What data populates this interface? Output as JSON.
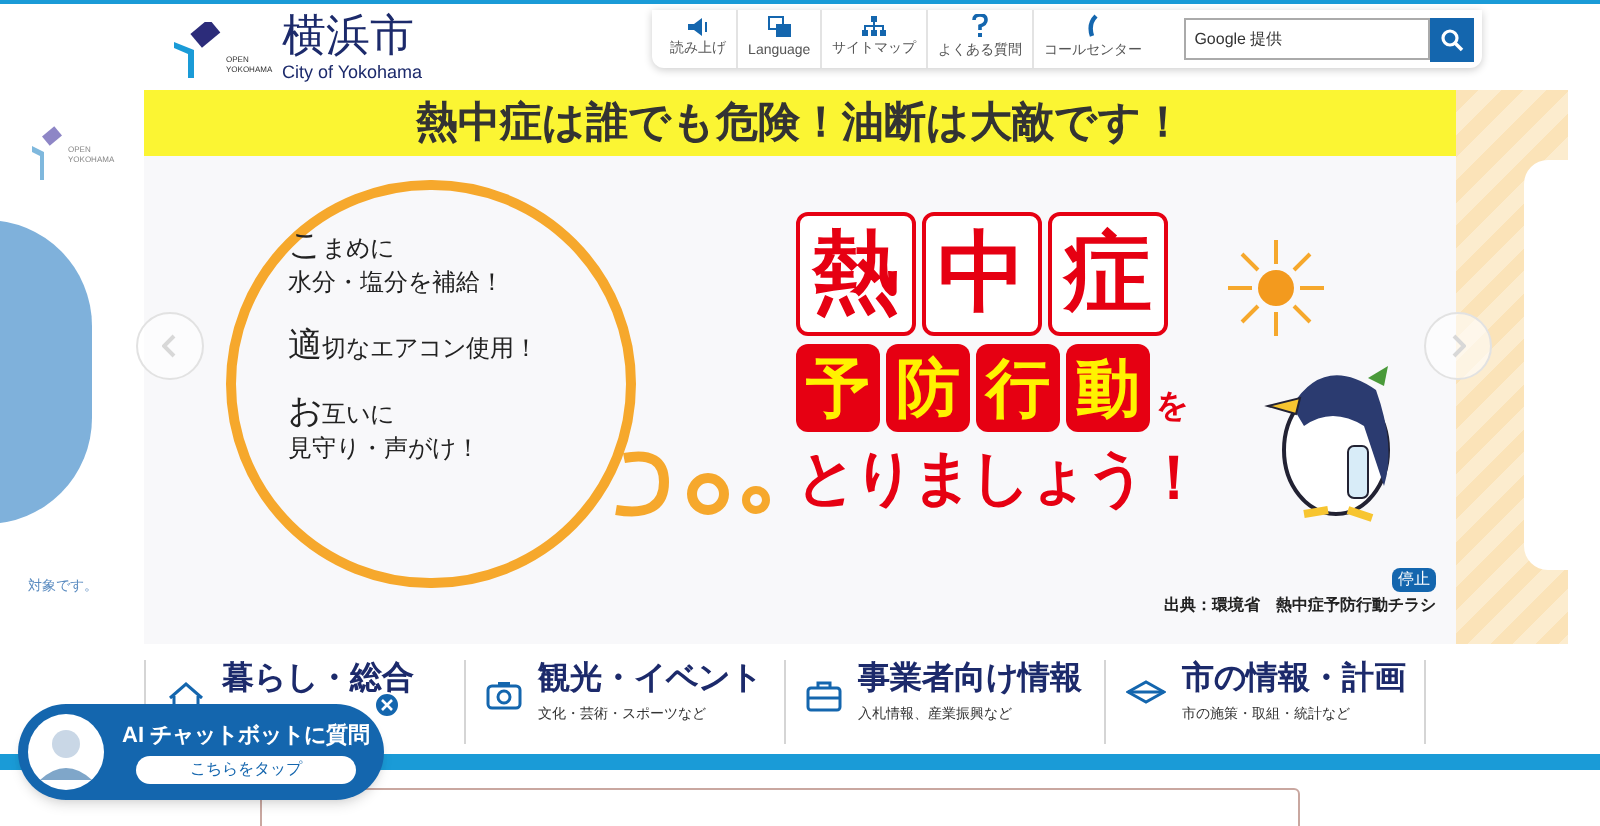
{
  "header": {
    "logo_title": "横浜市",
    "logo_subtitle": "City of Yokohama",
    "logo_mark_text": "OPEN YOKOHAMA",
    "tools": [
      {
        "kind": "speaker",
        "label": "読み上げ"
      },
      {
        "kind": "language",
        "label": "Language"
      },
      {
        "kind": "sitemap",
        "label": "サイトマップ"
      },
      {
        "kind": "question",
        "label": "よくある質問"
      },
      {
        "kind": "phone",
        "label": "コールセンター"
      }
    ],
    "search": {
      "placeholder": "Google 提供"
    }
  },
  "previous_slide": {
    "logo_mark_text": "OPEN YOKOHAMA",
    "caption": "対象です。"
  },
  "banner": {
    "headline": "熱中症は誰でも危険！油断は大敵です！",
    "bubble_lines": [
      {
        "first": "こ",
        "rest": "まめに",
        "second": "水分・塩分を補給！"
      },
      {
        "first": "適",
        "rest": "切なエアコン使用！"
      },
      {
        "first": "お",
        "rest": "互いに",
        "second": "見守り・声がけ！"
      }
    ],
    "title_chars": [
      "熱",
      "中",
      "症"
    ],
    "action_chars": [
      "予",
      "防",
      "行",
      "動"
    ],
    "particle": "を",
    "closing": "とりましょう！",
    "pause_button": "停止",
    "source": "出典：環境省　熱中症予防行動チラシ"
  },
  "categories": [
    {
      "kind": "home",
      "title": "暮らし・総合"
    },
    {
      "kind": "camera",
      "title": "観光・イベント",
      "subtitle": "文化・芸術・スポーツなど"
    },
    {
      "kind": "toolbox",
      "title": "事業者向け情報",
      "subtitle": "入札情報、産業振興など"
    },
    {
      "kind": "diamond",
      "title": "市の情報・計画",
      "subtitle": "市の施策・取組・統計など"
    }
  ],
  "chatbot": {
    "title": "AI チャットボットに質問",
    "button": "こちらをタップ"
  }
}
